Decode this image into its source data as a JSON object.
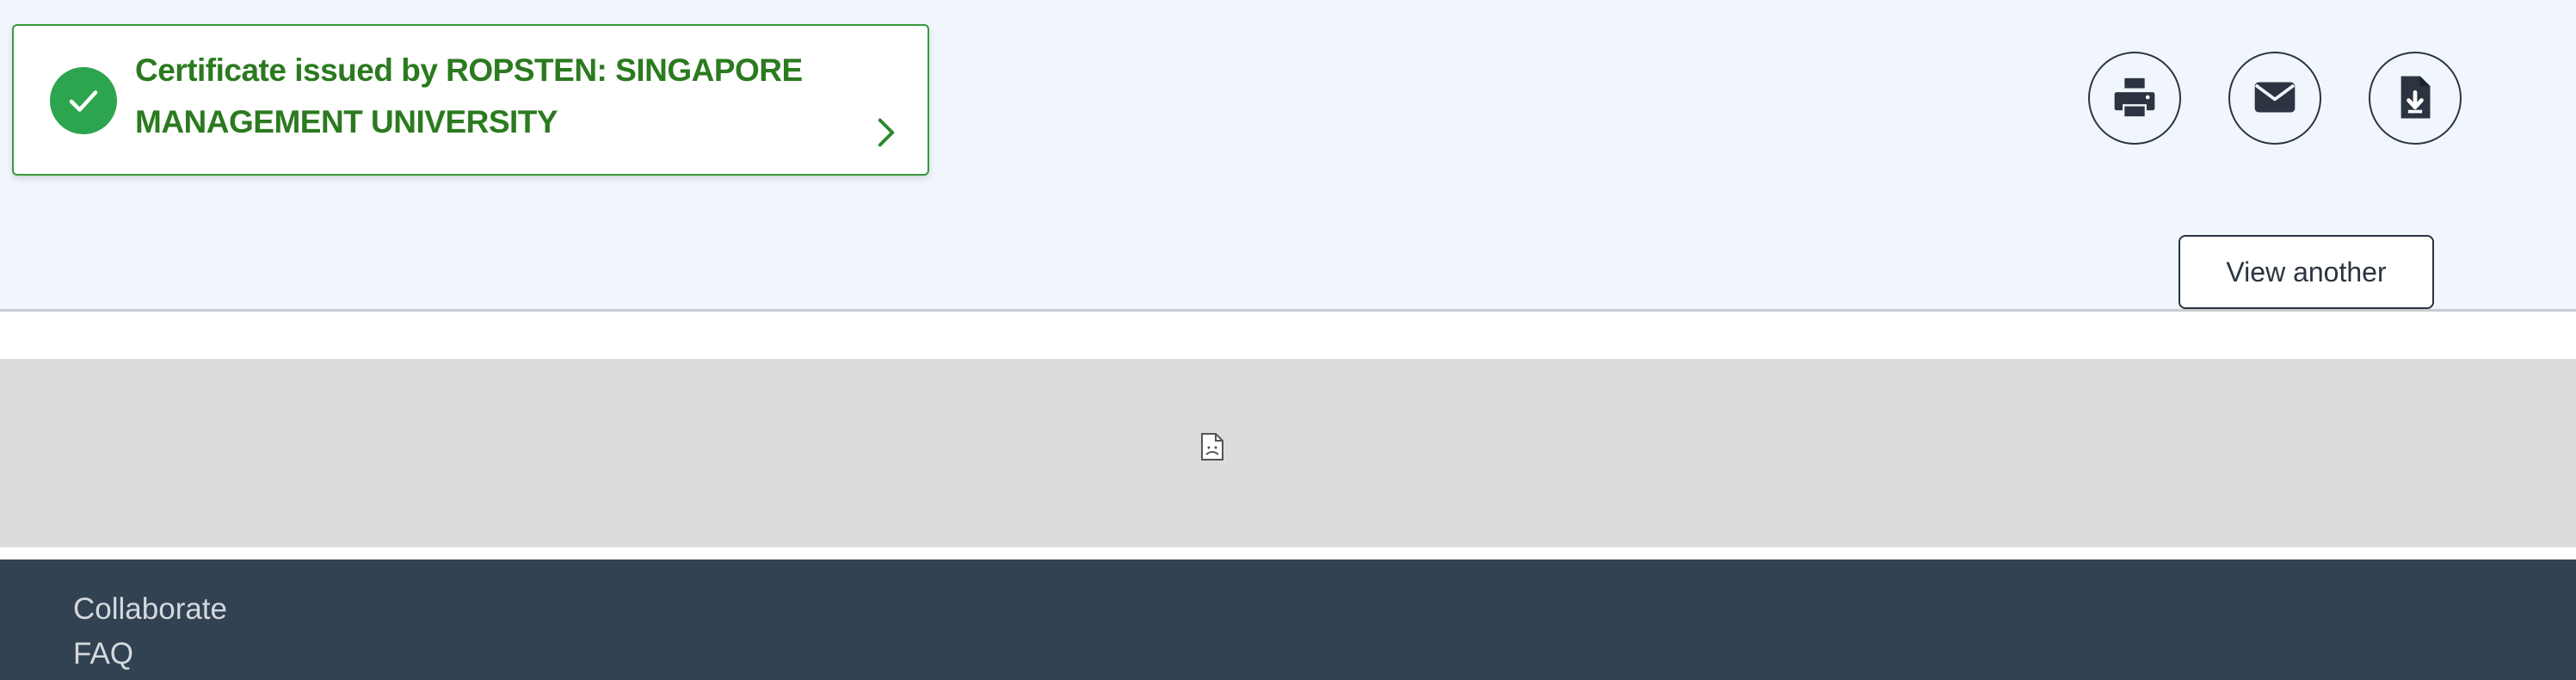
{
  "status": {
    "text": "Certificate issued by ROPSTEN: SINGAPORE MANAGEMENT UNIVERSITY",
    "color": "#2b7a1f",
    "check_color": "#2da44e",
    "icon": "check-circle-icon",
    "chevron_icon": "chevron-right-icon"
  },
  "actions": {
    "print_icon": "print-icon",
    "email_icon": "envelope-icon",
    "download_icon": "file-download-icon",
    "view_another_label": "View another"
  },
  "viewer": {
    "icon": "broken-document-icon"
  },
  "footer": {
    "links": [
      "Collaborate",
      "FAQ"
    ],
    "background": "#324252"
  }
}
